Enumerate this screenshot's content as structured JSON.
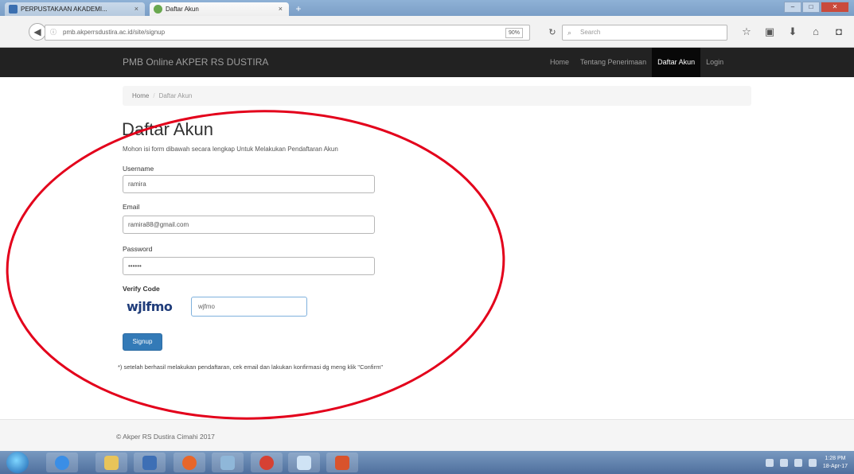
{
  "browser": {
    "tabs": [
      {
        "label": "PERPUSTAKAAN AKADEMI...",
        "close": "×"
      },
      {
        "label": "Daftar Akun",
        "close": "×"
      }
    ],
    "new_tab": "+",
    "url": "pmb.akperrsdustira.ac.id/site/signup",
    "zoom": "90%",
    "search_placeholder": "Search",
    "window_buttons": {
      "minimize": "–",
      "maximize": "□",
      "close": "✕"
    }
  },
  "navbar": {
    "brand": "PMB Online AKPER RS DUSTIRA",
    "links": [
      "Home",
      "Tentang Penerimaan",
      "Daftar Akun",
      "Login"
    ],
    "active": "Daftar Akun"
  },
  "breadcrumb": {
    "home": "Home",
    "current": "Daftar Akun"
  },
  "page": {
    "title": "Daftar Akun",
    "lead": "Mohon isi form dibawah secara lengkap Untuk Melakukan Pendaftaran Akun",
    "username_label": "Username",
    "username_value": "ramira",
    "email_label": "Email",
    "email_value": "ramira88@gmail.com",
    "password_label": "Password",
    "password_value": "••••••",
    "verify_label": "Verify Code",
    "captcha_text": "wjlfmo",
    "verify_value": "wjfmo",
    "signup_label": "Signup",
    "note": "*) setelah berhasil melakukan pendaftaran, cek email dan lakukan konfirmasi dg meng klik \"Confirm\""
  },
  "footer": {
    "text": "© Akper RS Dustira Cimahi 2017"
  },
  "taskbar": {
    "clock_time": "1:28 PM",
    "clock_date": "18-Apr-17"
  },
  "colors": {
    "navbar": "#222222",
    "primary": "#337ab7",
    "annotation": "#e3001b"
  }
}
